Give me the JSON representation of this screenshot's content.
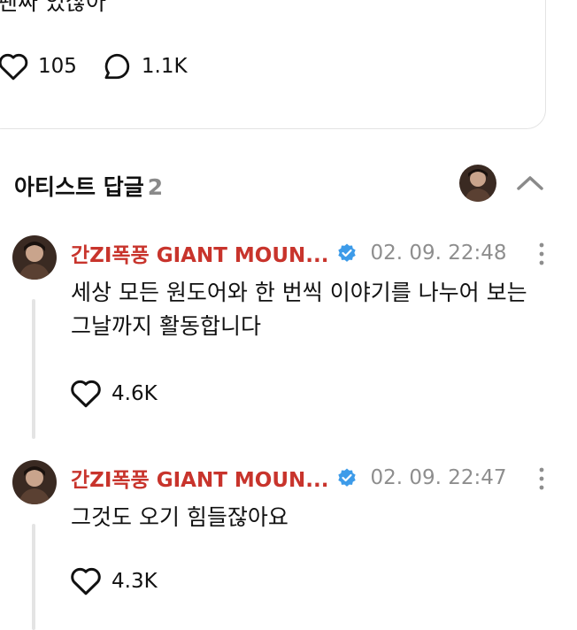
{
  "post": {
    "text": "팬싸 있잖아",
    "like_count": "105",
    "comment_count": "1.1K"
  },
  "artist_replies": {
    "title": "아티스트 답글",
    "count": "2"
  },
  "replies": [
    {
      "author": "간ZI폭풍 GIANT MOUN...",
      "timestamp": "02. 09. 22:48",
      "text": "세상 모든 원도어와 한 번씩 이야기를 나누어 보는 그날까지 활동합니다",
      "like_count": "4.6K"
    },
    {
      "author": "간ZI폭풍 GIANT MOUN...",
      "timestamp": "02. 09. 22:47",
      "text": "그것도 오기 힘들잖아요",
      "like_count": "4.3K"
    }
  ],
  "colors": {
    "author": "#c8342c",
    "verified": "#3d9be9",
    "muted": "#8e8e8e",
    "thread_line": "#e4e4e4"
  },
  "icons": [
    "heart-icon",
    "comment-bubble-icon",
    "chevron-up-icon",
    "verified-badge-icon",
    "more-vertical-icon"
  ]
}
